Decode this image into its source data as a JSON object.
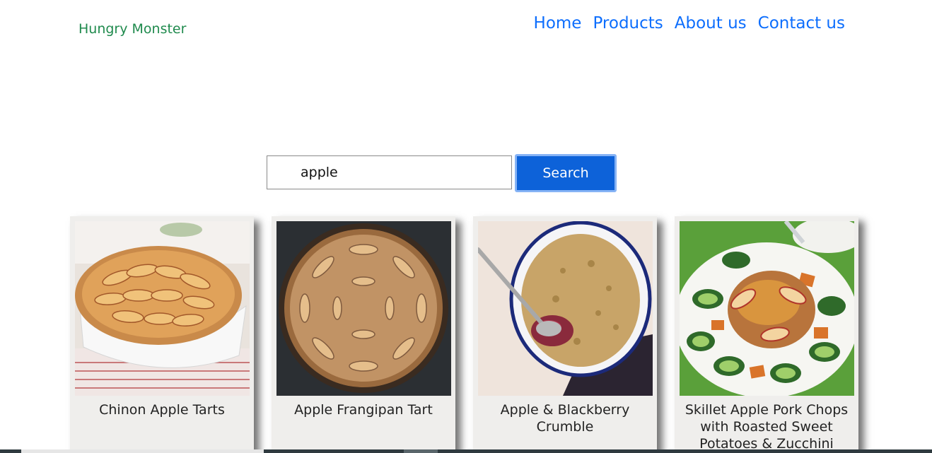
{
  "header": {
    "brand": "Hungry Monster",
    "nav": [
      "Home",
      "Products",
      "About us",
      "Contact us"
    ]
  },
  "search": {
    "value": "apple",
    "button_label": "Search"
  },
  "results": [
    {
      "title": "Chinon Apple Tarts",
      "image": "apple-tart-photo"
    },
    {
      "title": "Apple Frangipan Tart",
      "image": "frangipan-tart-photo"
    },
    {
      "title": "Apple & Blackberry Crumble",
      "image": "crumble-photo"
    },
    {
      "title": "Skillet Apple Pork Chops with Roasted Sweet Potatoes & Zucchini",
      "image": "pork-chops-photo"
    }
  ],
  "colors": {
    "brand": "#1f8a4d",
    "link": "#0d6efd",
    "button": "#0d62d9",
    "card_bg": "#efeeec"
  }
}
